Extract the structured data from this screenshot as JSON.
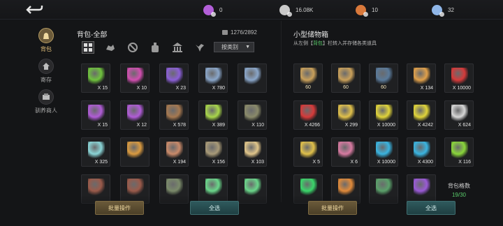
{
  "topbar": {
    "currencies": [
      {
        "icon": "purple-gem-icon",
        "value": "0",
        "color": "#b35fd9"
      },
      {
        "icon": "silver-coin-icon",
        "value": "16.08K",
        "color": "#c9c9c9"
      },
      {
        "icon": "copper-coin-icon",
        "value": "10",
        "color": "#d9793b"
      },
      {
        "icon": "blue-orb-icon",
        "value": "32",
        "color": "#8fb6e8"
      }
    ]
  },
  "nav": {
    "items": [
      {
        "label": "背包",
        "icon": "bag-icon",
        "active": true
      },
      {
        "label": "寄存",
        "icon": "house-icon",
        "active": false
      },
      {
        "label": "驯养商人",
        "icon": "merchant-icon",
        "active": false
      }
    ]
  },
  "bag": {
    "title": "背包-全部",
    "capacity": "1276/2892",
    "sort_label": "按类别",
    "filters": [
      "all-icon",
      "ore-icon",
      "material-icon",
      "potion-icon",
      "building-icon",
      "pet-icon"
    ],
    "items": [
      {
        "icon": "herb-leaf-icon",
        "count": "X 15",
        "color": "#6fc23d"
      },
      {
        "icon": "pink-flower-icon",
        "count": "X 10",
        "color": "#d14fb0"
      },
      {
        "icon": "purple-crystal-icon",
        "count": "X 23",
        "color": "#8b5fd6"
      },
      {
        "icon": "crystal-cluster-icon",
        "count": "X 780",
        "color": "#8aa6c9"
      },
      {
        "icon": "crystal-cluster-icon",
        "count": "",
        "color": "#8aa6c9"
      },
      {
        "icon": "purple-potion-icon",
        "count": "X 15",
        "color": "#b05cd6"
      },
      {
        "icon": "purple-potion-icon",
        "count": "X 12",
        "color": "#b05cd6"
      },
      {
        "icon": "wood-log-icon",
        "count": "X 578",
        "color": "#a57850"
      },
      {
        "icon": "green-ore-icon",
        "count": "X 389",
        "color": "#a8d64a"
      },
      {
        "icon": "dark-ore-icon",
        "count": "X 110",
        "color": "#8a8a6a"
      },
      {
        "icon": "ice-crystal-icon",
        "count": "X 325",
        "color": "#8ad4d6"
      },
      {
        "icon": "orange-potion-icon",
        "count": "",
        "color": "#d99a40"
      },
      {
        "icon": "copper-ore-icon",
        "count": "X 194",
        "color": "#c98a6a"
      },
      {
        "icon": "chain-link-icon",
        "count": "X 156",
        "color": "#a89a78"
      },
      {
        "icon": "gold-ore-icon",
        "count": "X 103",
        "color": "#e0c58a"
      },
      {
        "icon": "meat-icon",
        "count": "",
        "color": "#9a5a4a"
      },
      {
        "icon": "meat-icon",
        "count": "",
        "color": "#9a5a4a"
      },
      {
        "icon": "fish-icon",
        "count": "",
        "color": "#7a8a6a"
      },
      {
        "icon": "green-orb-icon",
        "count": "",
        "color": "#6ad68a"
      },
      {
        "icon": "green-orb-icon",
        "count": "",
        "color": "#6ad68a"
      }
    ],
    "batch_label": "批量操作",
    "select_all_label": "全选"
  },
  "storage": {
    "title": "小型储物箱",
    "subtitle_prefix": "从左侧【",
    "subtitle_highlight": "背包",
    "subtitle_suffix": "】栏转入并存储各类道具",
    "items": [
      {
        "icon": "ancient-seal-icon",
        "count": "",
        "level": "60",
        "color": "#c9a05a"
      },
      {
        "icon": "ancient-seal-icon",
        "count": "",
        "level": "60",
        "color": "#c9a05a"
      },
      {
        "icon": "dark-seal-icon",
        "count": "",
        "level": "60",
        "color": "#5a7a9a"
      },
      {
        "icon": "orange-vial-icon",
        "count": "X 134",
        "level": "",
        "color": "#e0a04a"
      },
      {
        "icon": "red-powder-icon",
        "count": "X 10000",
        "level": "",
        "color": "#d63a3a"
      },
      {
        "icon": "red-powder-icon",
        "count": "X 4266",
        "level": "",
        "color": "#d63a3a"
      },
      {
        "icon": "gold-vial-icon",
        "count": "X 299",
        "level": "",
        "color": "#e0c04a"
      },
      {
        "icon": "yellow-powder-icon",
        "count": "X 10000",
        "level": "",
        "color": "#e0d43a"
      },
      {
        "icon": "yellow-powder-icon",
        "count": "X 4242",
        "level": "",
        "color": "#e0d43a"
      },
      {
        "icon": "white-vial-icon",
        "count": "X 624",
        "level": "",
        "color": "#d6d6d6"
      },
      {
        "icon": "gold-potion-icon",
        "count": "X 5",
        "level": "",
        "color": "#e0c04a"
      },
      {
        "icon": "pink-potion-icon",
        "count": "X 6",
        "level": "",
        "color": "#d67aa0"
      },
      {
        "icon": "blue-powder-icon",
        "count": "X 10000",
        "level": "",
        "color": "#3ab4e0"
      },
      {
        "icon": "blue-powder-icon",
        "count": "X 4300",
        "level": "",
        "color": "#3ab4e0"
      },
      {
        "icon": "green-potion-icon",
        "count": "X 116",
        "level": "",
        "color": "#8ad63a"
      },
      {
        "icon": "green-powder-icon",
        "count": "",
        "level": "",
        "color": "#3ad66a"
      },
      {
        "icon": "flame-feather-icon",
        "count": "",
        "level": "",
        "color": "#e08a3a"
      },
      {
        "icon": "green-seal-icon",
        "count": "",
        "level": "",
        "color": "#5aa06a"
      },
      {
        "icon": "purple-bottle-icon",
        "count": "",
        "level": "",
        "color": "#9a5ad6"
      }
    ],
    "capacity_label": "背包格数",
    "capacity_value": "19/30",
    "capacity_color": "#5bd06c",
    "batch_label": "批量操作",
    "select_all_label": "全选"
  }
}
